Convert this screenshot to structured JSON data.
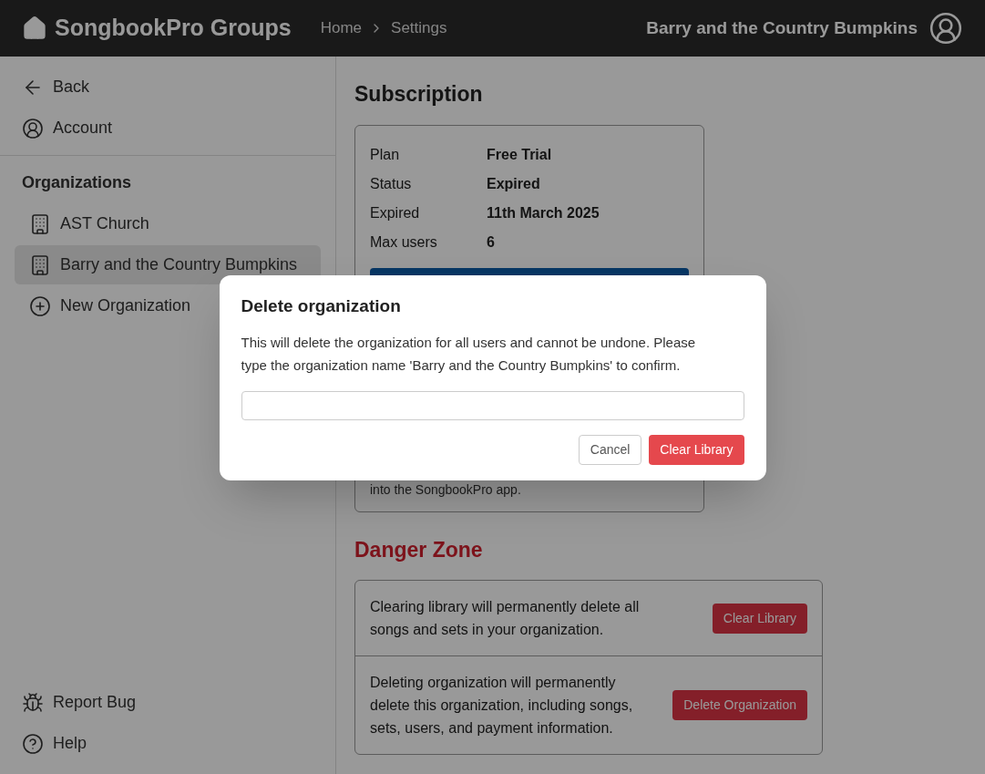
{
  "header": {
    "app_name": "SongbookPro Groups",
    "breadcrumbs": [
      "Home",
      "Settings"
    ],
    "organization": "Barry and the Country Bumpkins"
  },
  "sidebar": {
    "top_items": [
      {
        "kind": "back",
        "label": "Back"
      },
      {
        "kind": "account",
        "label": "Account"
      }
    ],
    "organizations_heading": "Organizations",
    "organizations": [
      {
        "kind": "org",
        "label": "AST Church",
        "selected": false
      },
      {
        "kind": "org",
        "label": "Barry and the Country Bumpkins",
        "selected": true
      },
      {
        "kind": "new",
        "label": "New Organization",
        "selected": false
      }
    ],
    "bottom_items": [
      {
        "kind": "bug",
        "label": "Report Bug"
      },
      {
        "kind": "help",
        "label": "Help"
      }
    ]
  },
  "subscription": {
    "title": "Subscription",
    "rows": [
      {
        "label": "Plan",
        "value": "Free Trial"
      },
      {
        "label": "Status",
        "value": "Expired"
      },
      {
        "label": "Expired",
        "value": "11th March 2025"
      },
      {
        "label": "Max users",
        "value": "6"
      }
    ],
    "note_tail": "into the SongbookPro app."
  },
  "danger_zone": {
    "title": "Danger Zone",
    "items": [
      {
        "text": "Clearing library will permanently delete all songs and sets in your organization.",
        "button": "Clear Library"
      },
      {
        "text": "Deleting organization will permanently delete this organization, including songs, sets, users, and payment information.",
        "button": "Delete Organization"
      }
    ]
  },
  "dialog": {
    "title": "Delete organization",
    "message": "This will delete the organization for all users and cannot be undone. Please type the organization name 'Barry and the Country Bumpkins' to confirm.",
    "cancel": "Cancel",
    "confirm": "Clear Library"
  }
}
